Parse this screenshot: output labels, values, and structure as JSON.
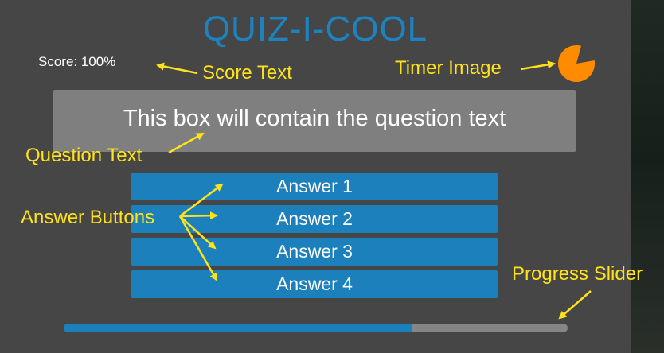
{
  "app": {
    "title": "QUIZ-I-COOL"
  },
  "score": {
    "text": "Score: 100%"
  },
  "timer": {
    "icon": "timer-pie-icon",
    "color": "#ff8c00"
  },
  "question": {
    "text": "This box will contain the question text"
  },
  "answers": [
    {
      "label": "Answer 1"
    },
    {
      "label": "Answer 2"
    },
    {
      "label": "Answer 3"
    },
    {
      "label": "Answer 4"
    }
  ],
  "progress": {
    "fraction": 0.69
  },
  "annotations": {
    "score_text": "Score Text",
    "timer_image": "Timer Image",
    "question_text": "Question Text",
    "answer_buttons": "Answer Buttons",
    "progress_slider": "Progress Slider"
  },
  "colors": {
    "accent": "#1c80bd",
    "callout": "#ffe21a",
    "background": "#464646"
  }
}
